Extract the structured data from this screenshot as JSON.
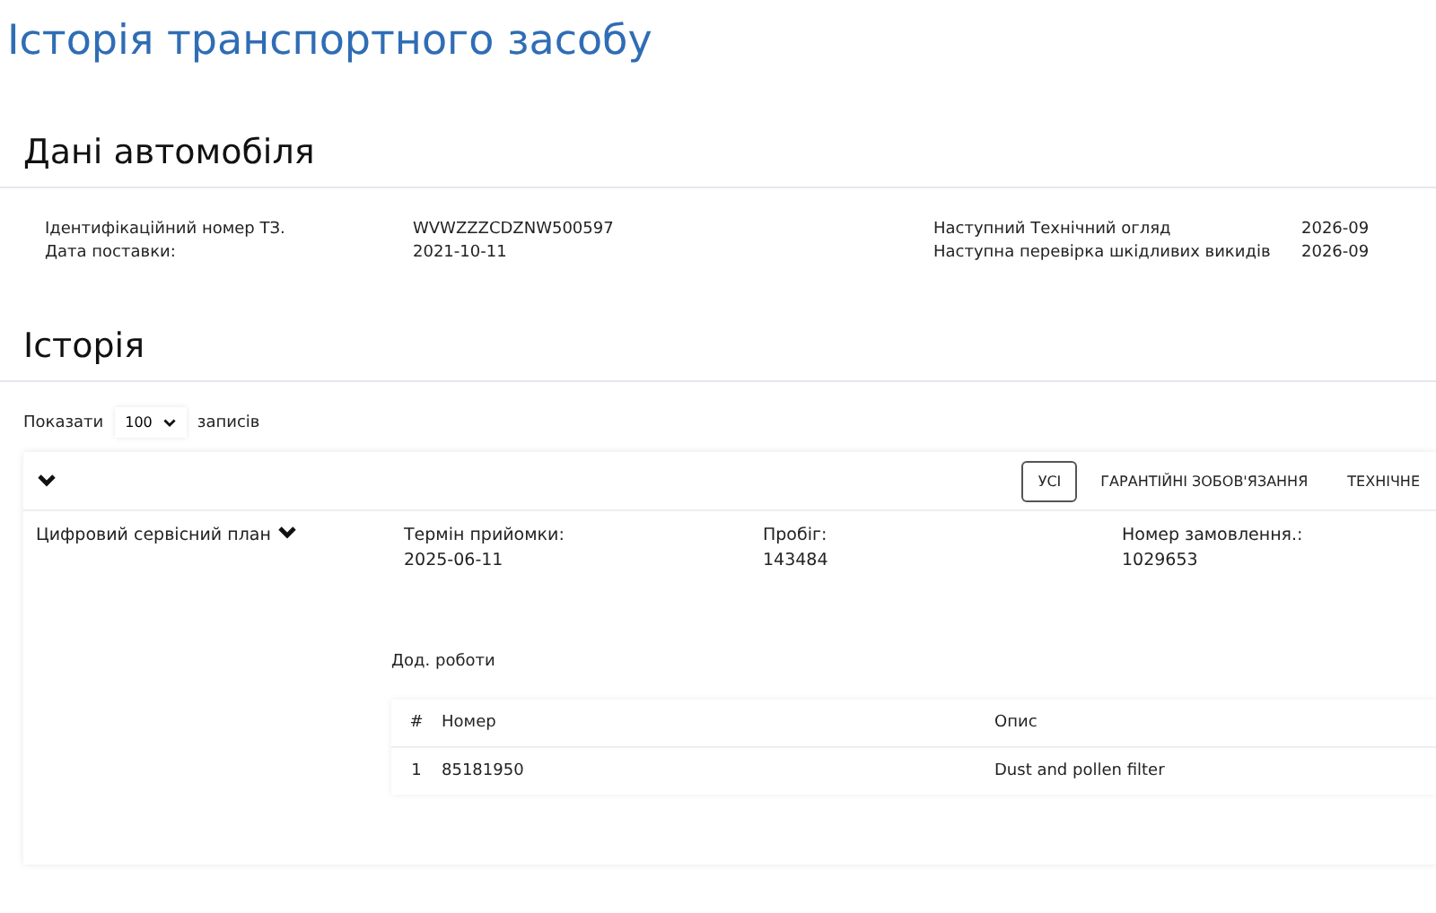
{
  "page_title": "Історія транспортного засобу",
  "vehicle": {
    "heading": "Дані автомобіля",
    "left": [
      {
        "label": "Ідентифікаційний номер ТЗ.",
        "value": "WVWZZZCDZNW500597"
      },
      {
        "label": "Дата поставки:",
        "value": "2021-10-11"
      }
    ],
    "right": [
      {
        "label": "Наступний Технічний огляд",
        "value": "2026-09"
      },
      {
        "label": "Наступна перевірка шкідливих викидів",
        "value": "2026-09"
      }
    ]
  },
  "history": {
    "heading": "Історія",
    "show_label": "Показати",
    "page_size": "100",
    "records_label": "записів",
    "tabs": [
      {
        "label": "УСІ",
        "selected": true
      },
      {
        "label": "ГАРАНТІЙНІ ЗОБОВ'ЯЗАННЯ",
        "selected": false
      },
      {
        "label": "ТЕХНІЧНЕ",
        "selected": false
      }
    ],
    "entry": {
      "plan": "Цифровий сервісний план",
      "fields": [
        {
          "label": "Термін прийомки:",
          "value": "2025-06-11"
        },
        {
          "label": "Пробіг:",
          "value": "143484"
        },
        {
          "label": "Номер замовлення.:",
          "value": "1029653"
        }
      ],
      "extra_heading": "Дод. роботи",
      "columns": [
        "#",
        "Номер",
        "Опис"
      ],
      "rows": [
        [
          "1",
          "85181950",
          "Dust and pollen filter"
        ]
      ]
    }
  }
}
